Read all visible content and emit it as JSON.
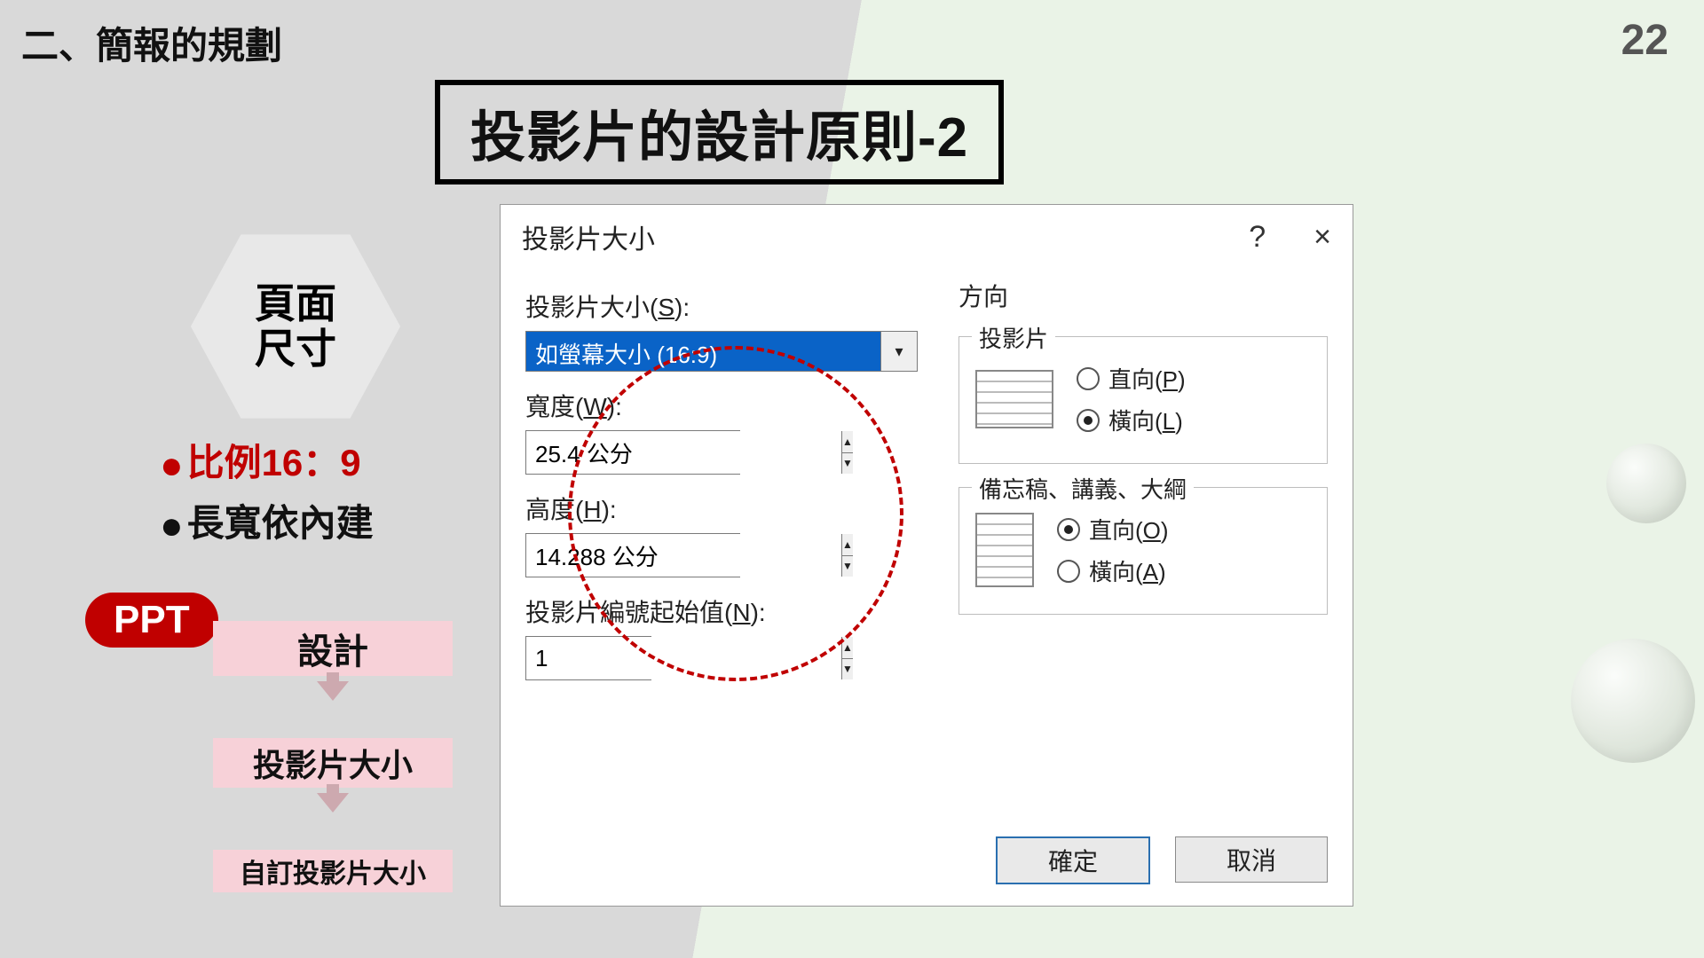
{
  "page": {
    "section": "二、簡報的規劃",
    "number": "22",
    "title": "投影片的設計原則-2"
  },
  "hex": {
    "line1": "頁面",
    "line2": "尺寸"
  },
  "bullets": {
    "b1": "比例16：9",
    "b2": "長寬依內建"
  },
  "ppt": {
    "label": "PPT",
    "steps": {
      "s1": "設計",
      "s2": "投影片大小",
      "s3": "自訂投影片大小"
    }
  },
  "dialog": {
    "title": "投影片大小",
    "help": "?",
    "close": "×",
    "size_label_pre": "投影片大小(",
    "size_label_u": "S",
    "size_label_post": "):",
    "size_value": "如螢幕大小 (16:9)",
    "width_label_pre": "寬度(",
    "width_label_u": "W",
    "width_label_post": "):",
    "width_value": "25.4 公分",
    "height_label_pre": "高度(",
    "height_label_u": "H",
    "height_label_post": "):",
    "height_value": "14.288 公分",
    "start_label_pre": "投影片編號起始值(",
    "start_label_u": "N",
    "start_label_post": "):",
    "start_value": "1",
    "orientation_group": "方向",
    "slide_group": "投影片",
    "notes_group": "備忘稿、講義、大綱",
    "portrait_pre": "直向(",
    "landscape_pre": "橫向(",
    "p_u": "P",
    "l_u": "L",
    "o_u": "O",
    "a_u": "A",
    "close_paren": ")",
    "ok": "確定",
    "cancel": "取消"
  }
}
